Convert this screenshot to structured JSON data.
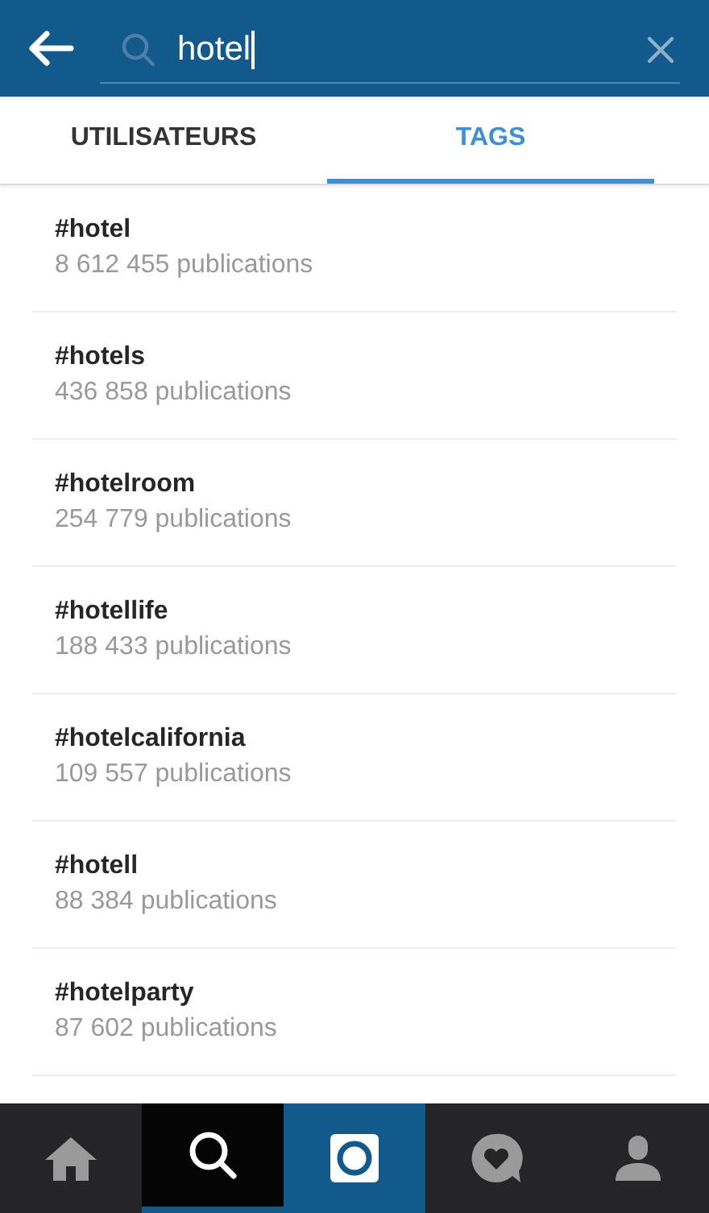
{
  "search": {
    "value": "hotel"
  },
  "tabs": [
    {
      "label": "UTILISATEURS",
      "selected": false
    },
    {
      "label": "TAGS",
      "selected": true
    }
  ],
  "results": [
    {
      "tag": "#hotel",
      "count": "8 612 455 publications"
    },
    {
      "tag": "#hotels",
      "count": "436 858 publications"
    },
    {
      "tag": "#hotelroom",
      "count": "254 779 publications"
    },
    {
      "tag": "#hotellife",
      "count": "188 433 publications"
    },
    {
      "tag": "#hotelcalifornia",
      "count": "109 557 publications"
    },
    {
      "tag": "#hotell",
      "count": "88 384 publications"
    },
    {
      "tag": "#hotelparty",
      "count": "87 602 publications"
    }
  ],
  "nav": [
    {
      "kind": "home",
      "selected": false
    },
    {
      "kind": "search",
      "selected": true
    },
    {
      "kind": "camera",
      "selected": false
    },
    {
      "kind": "activity",
      "selected": false
    },
    {
      "kind": "profile",
      "selected": false
    }
  ]
}
